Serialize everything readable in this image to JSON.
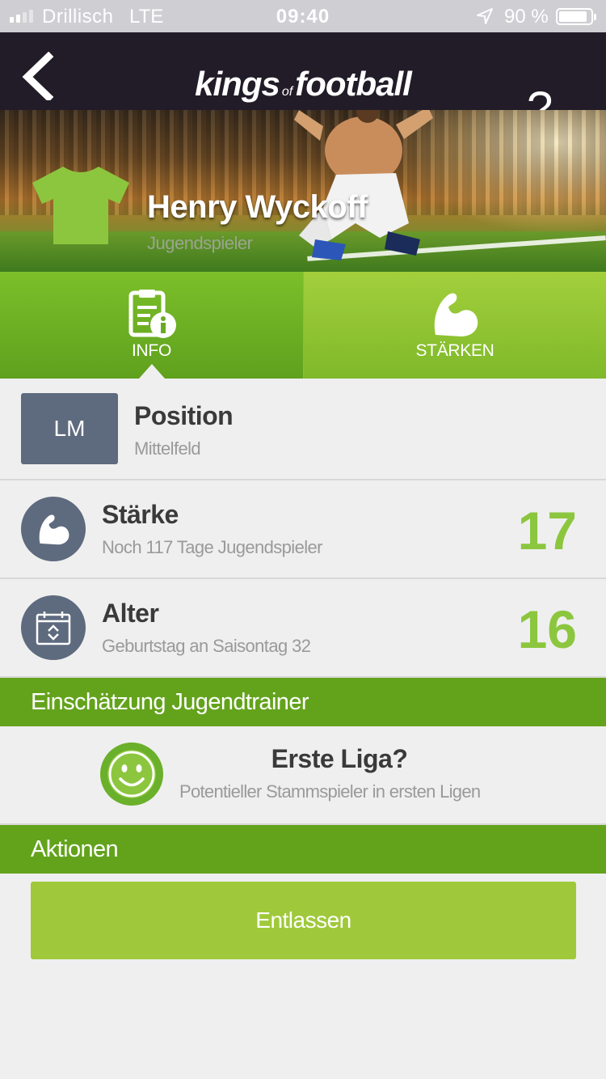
{
  "status_bar": {
    "carrier": "Drillisch",
    "network": "LTE",
    "time": "09:40",
    "battery_percent": "90 %",
    "battery_level": 0.9,
    "signal_bars_filled": 2,
    "location_icon": "location-arrow-icon"
  },
  "nav": {
    "back_icon": "chevron-left-icon",
    "logo_part1": "kings",
    "logo_part2": "of",
    "logo_part3": "football",
    "help_label": "?"
  },
  "player": {
    "name": "Henry Wyckoff",
    "role": "Jugendspieler",
    "shirt_color": "#8cc63e"
  },
  "tabs": [
    {
      "label": "INFO",
      "icon": "info-clipboard-icon",
      "active": true
    },
    {
      "label": "STÄRKEN",
      "icon": "flexed-arm-icon",
      "active": false
    }
  ],
  "info": {
    "position": {
      "badge": "LM",
      "title": "Position",
      "subtitle": "Mittelfeld"
    },
    "strength": {
      "title": "Stärke",
      "subtitle": "Noch 117 Tage Jugendspieler",
      "value": "17",
      "icon": "flexed-arm-icon"
    },
    "age": {
      "title": "Alter",
      "subtitle": "Geburtstag an Saisontag 32",
      "value": "16",
      "icon": "calendar-icon"
    }
  },
  "assessment": {
    "header": "Einschätzung Jugendtrainer",
    "title": "Erste Liga?",
    "subtitle": "Potentieller Stammspieler in ersten Ligen",
    "icon": "smiley-icon"
  },
  "actions": {
    "header": "Aktionen",
    "release_label": "Entlassen"
  },
  "colors": {
    "accent_green": "#63a31c",
    "value_green": "#8cc63e",
    "button_green": "#9fc93a",
    "badge_slate": "#5e6a7e",
    "navbar_dark": "#221c28"
  }
}
